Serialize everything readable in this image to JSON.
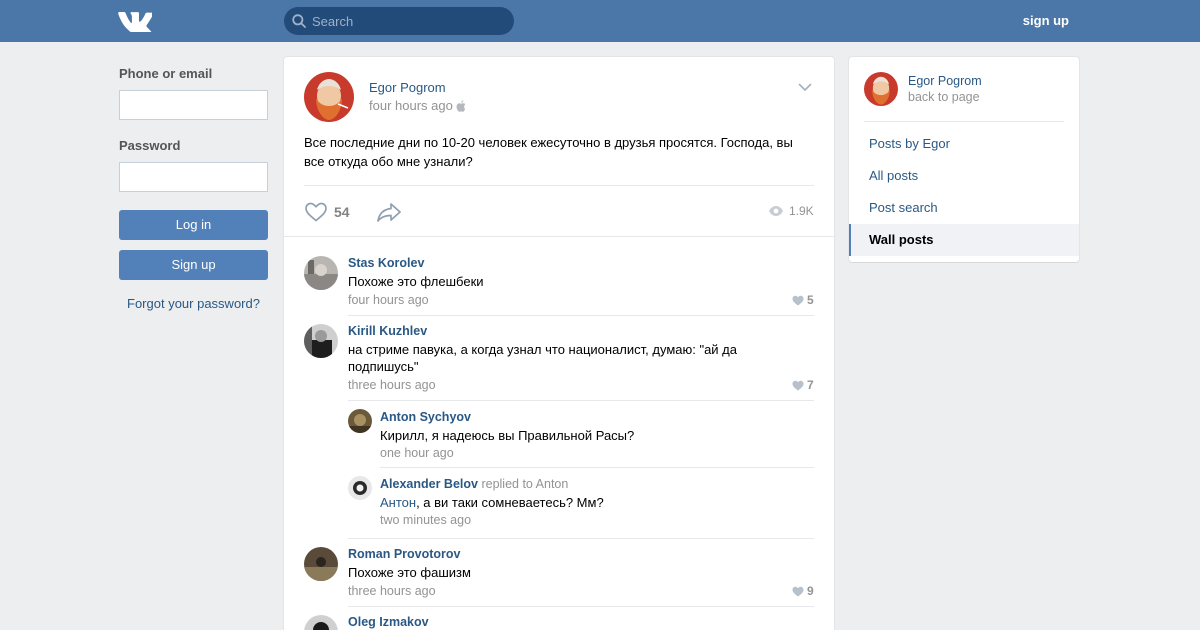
{
  "header": {
    "search_placeholder": "Search",
    "signup_label": "sign up"
  },
  "login": {
    "phone_label": "Phone or email",
    "password_label": "Password",
    "login_button": "Log in",
    "signup_button": "Sign up",
    "forgot_link": "Forgot your password?"
  },
  "post": {
    "author": "Egor Pogrom",
    "time": "four hours ago",
    "text": "Все последние дни по 10-20 человек ежесуточно в друзья просятся. Господа, вы все откуда обо мне узнали?",
    "likes": "54",
    "views": "1.9K"
  },
  "comments": [
    {
      "author": "Stas Korolev",
      "text": "Похоже это флешбеки",
      "time": "four hours ago",
      "likes": "5"
    },
    {
      "author": "Kirill Kuzhlev",
      "text_line1": "на стриме павука, а когда узнал что националист, думаю: \"ай да",
      "text_line2": "подпишусь\"",
      "time": "three hours ago",
      "likes": "7"
    },
    {
      "author": "Anton Sychyov",
      "text": "Кирилл, я надеюсь вы Правильной Расы?",
      "time": "one hour ago"
    },
    {
      "author": "Alexander Belov",
      "replied": "replied to Anton",
      "mention": "Антон",
      "text": ", а ви таки сомневаетесь? Мм?",
      "time": "two minutes ago"
    },
    {
      "author": "Roman Provotorov",
      "text": "Похоже это фашизм",
      "time": "three hours ago",
      "likes": "9"
    },
    {
      "author": "Oleg Izmakov"
    }
  ],
  "sidebar": {
    "author": "Egor Pogrom",
    "back": "back to page",
    "items": [
      {
        "label": "Posts by Egor"
      },
      {
        "label": "All posts"
      },
      {
        "label": "Post search"
      },
      {
        "label": "Wall posts",
        "active": true
      }
    ]
  },
  "colors": {
    "header": "#4a76a8",
    "link": "#2a5885",
    "button": "#5181b8",
    "background": "#edeef0"
  },
  "icons": [
    "vk-logo-icon",
    "search-icon",
    "apple-icon",
    "chevron-down-icon",
    "heart-icon",
    "share-icon",
    "eye-icon"
  ]
}
